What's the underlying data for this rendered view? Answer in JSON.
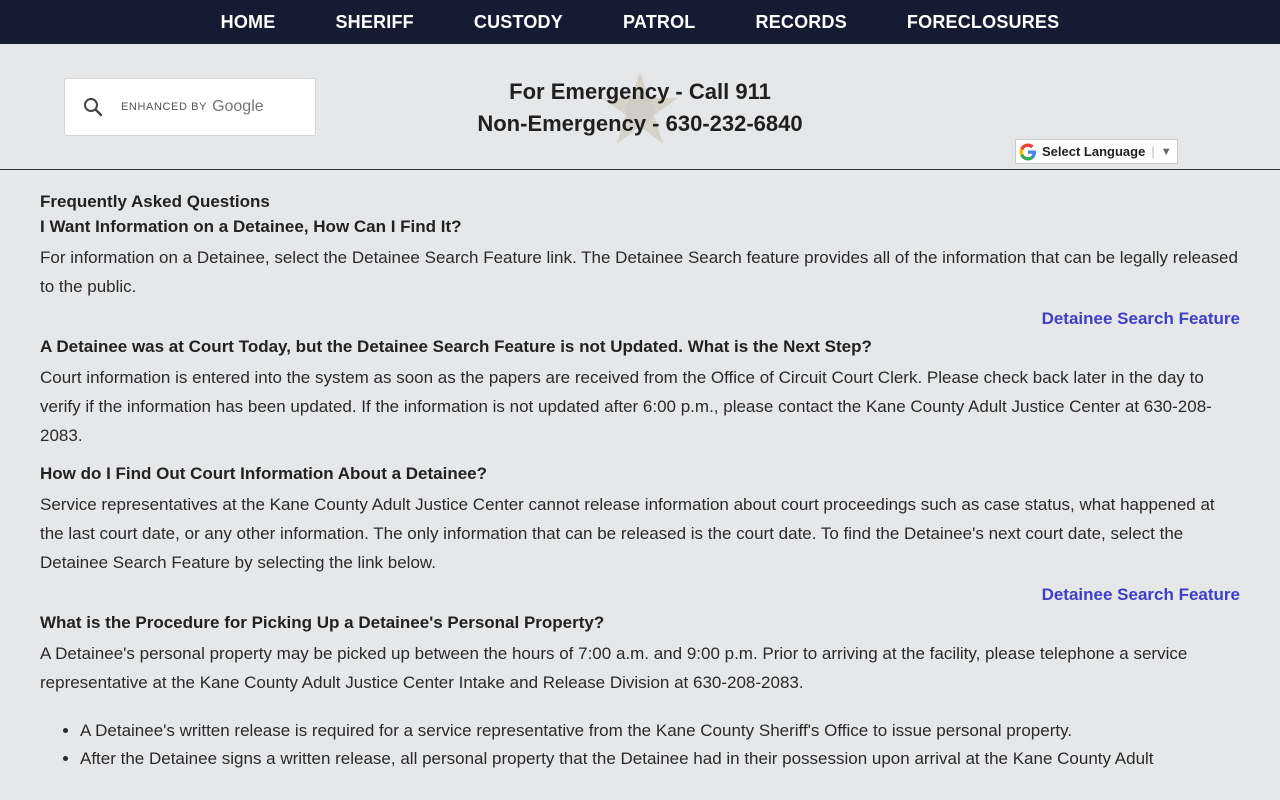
{
  "nav": {
    "items": [
      "HOME",
      "SHERIFF",
      "CUSTODY",
      "PATROL",
      "RECORDS",
      "FORECLOSURES"
    ]
  },
  "search": {
    "enhanced_by": "ENHANCED BY",
    "google": "Google"
  },
  "emergency": {
    "line1_label": "For Emergency - Call 911",
    "line2_label": "Non-Emergency - 630-232-6840"
  },
  "translate": {
    "label": "Select Language",
    "arrow": "▼"
  },
  "faq": {
    "title": "Frequently Asked Questions",
    "q1": {
      "question": "I Want Information on a Detainee, How Can I Find It?",
      "answer": "For information on a Detainee, select the Detainee Search Feature link.  The Detainee Search feature provides all of the information that can be legally released to the public.",
      "link": "Detainee Search Feature"
    },
    "q2": {
      "question": "A Detainee was at Court Today, but the Detainee Search Feature is not Updated.  What is the Next Step?",
      "answer": "Court information is entered into the system as soon as the papers are received from the Office of Circuit Court Clerk.  Please check back later in the day to verify if the information has been updated.  If the information is not updated after 6:00 p.m., please contact the Kane County Adult Justice Center at 630-208-2083."
    },
    "q3": {
      "question": "How do I Find Out Court Information About a Detainee?",
      "answer": "Service representatives at the Kane County Adult Justice Center cannot release information about court proceedings such as case status, what happened at the last court date, or any other information.  The only information that can be released is the court date.  To find the Detainee's next court date, select the Detainee Search Feature by selecting the link below.",
      "link": "Detainee Search Feature"
    },
    "q4": {
      "question": "What is the Procedure for Picking Up a Detainee's Personal Property?",
      "answer": "A Detainee's personal property may be picked up between the hours of 7:00 a.m. and 9:00 p.m.  Prior to arriving at the facility, please telephone a service representative at the Kane County Adult Justice Center Intake and Release Division at 630-208-2083.",
      "bullets": [
        "A Detainee's written release is required for a service representative from the Kane County Sheriff's Office to issue personal property.",
        "After the Detainee signs a written release, all personal property that the Detainee had in their possession upon arrival at the Kane County Adult"
      ]
    }
  }
}
